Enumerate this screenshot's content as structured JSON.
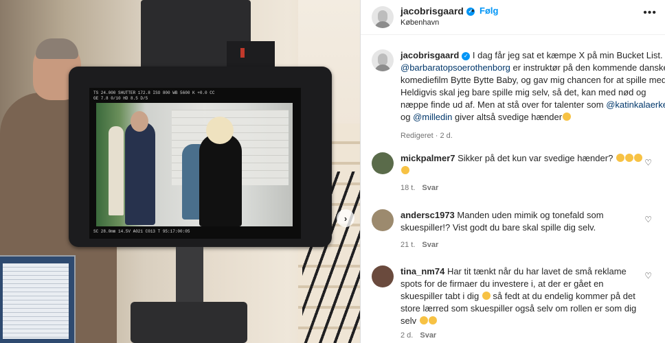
{
  "post": {
    "username": "jacobrisgaard",
    "follow_label": "Følg",
    "location": "København",
    "more_label": "•••",
    "next_label": "›"
  },
  "caption": {
    "username": "jacobrisgaard",
    "text_1": "I dag får jeg sat et kæmpe X på min Bucket List.",
    "mention_1": "@barbaratopsoerothenborg",
    "text_2": "er instruktør på den kommende danske komediefilm Bytte Bytte Baby, og gav mig chancen for at spille med. Heldigvis skal jeg bare spille mig selv, så det, kan med nød og næppe finde ud af. Men at stå over for talenter som",
    "mention_2": "@katinkalaerke",
    "text_3": "og",
    "mention_3": "@milledin",
    "text_4": "giver altså svedige hænder",
    "edited": "Redigeret · 2 d."
  },
  "comments": [
    {
      "username": "mickpalmer7",
      "text": "Sikker på det kun var svedige hænder?",
      "time": "18 t.",
      "reply": "Svar"
    },
    {
      "username": "andersc1973",
      "text": "Manden uden mimik og tonefald som skuespiller!? Vist godt du bare skal spille dig selv.",
      "time": "21 t.",
      "reply": "Svar"
    },
    {
      "username": "tina_nm74",
      "text": "Har tit tænkt når du har lavet de små reklame spots for de firmaer du investere i, at der er gået en skuespiller tabt i dig",
      "text_b": "så fedt at du endelig kommer på det store lærred som skuespiller også selv om rollen er som dig selv",
      "time": "2 d.",
      "reply": "Svar"
    }
  ],
  "monitor_hud": {
    "top": "TS 24.000   SHUTTER 172.8   ISO 800   WB 5600 K   +0.0 CC",
    "row2": "GE 7.8   0/10   HD 8.5   D/5",
    "bottom": "SC 28.0mm   14.5V   A021 C013   T 95:17:00:05"
  },
  "colors": {
    "accent": "#0095f6",
    "link": "#00376b",
    "muted": "#737373"
  }
}
